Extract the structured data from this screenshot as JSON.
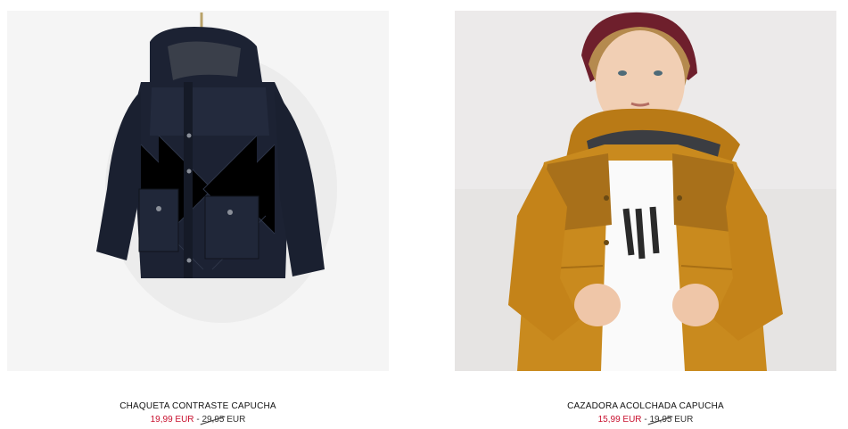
{
  "products": [
    {
      "name": "CHAQUETA CONTRASTE CAPUCHA",
      "sale_price": "19,99 EUR",
      "separator": "-",
      "old_price_number": "29,95",
      "old_price_currency": "EUR",
      "image_icon": "navy-quilted-jacket-on-hanger"
    },
    {
      "name": "CAZADORA ACOLCHADA CAPUCHA",
      "sale_price": "15,99 EUR",
      "separator": "-",
      "old_price_number": "19,95",
      "old_price_currency": "EUR",
      "image_icon": "boy-in-mustard-puffer-jacket"
    }
  ],
  "colors": {
    "sale": "#c8102e",
    "text": "#111111",
    "navy": "#1c2233",
    "mustard": "#c98a1e"
  }
}
